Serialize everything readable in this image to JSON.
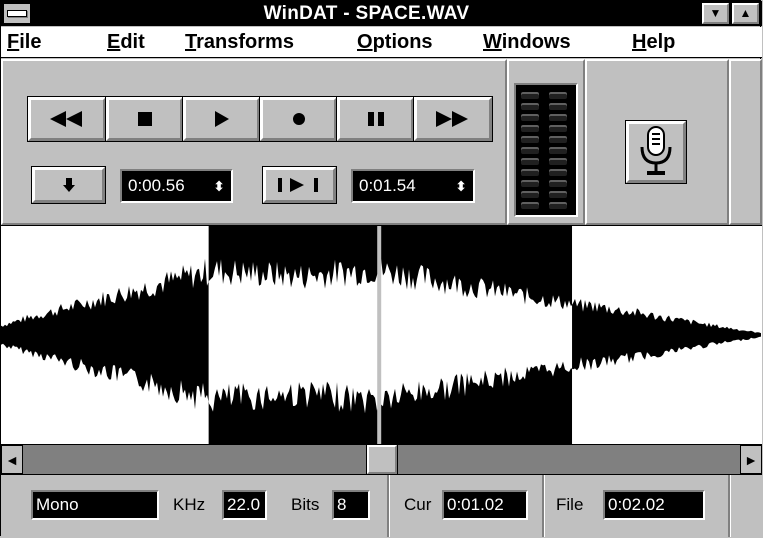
{
  "window": {
    "title": "WinDAT - SPACE.WAV",
    "minimize_glyph": "▼",
    "maximize_glyph": "▲"
  },
  "menu": [
    {
      "first": "F",
      "rest": "ile"
    },
    {
      "first": "E",
      "rest": "dit"
    },
    {
      "first": "T",
      "rest": "ransforms"
    },
    {
      "first": "O",
      "rest": "ptions"
    },
    {
      "first": "W",
      "rest": "indows"
    },
    {
      "first": "H",
      "rest": "elp"
    }
  ],
  "transport": {
    "buttons": [
      "rewind-icon",
      "stop-icon",
      "play-icon",
      "record-icon",
      "pause-icon",
      "fast-forward-icon"
    ]
  },
  "selection": {
    "start_time": "0:00.56",
    "end_time": "0:01.54",
    "spin_glyph": "⬍"
  },
  "waveform": {
    "duration_seconds": 2.02,
    "selection_start_seconds": 0.56,
    "selection_end_seconds": 1.54,
    "cursor_seconds": 1.02
  },
  "scrollbar": {
    "left_arrow": "◄",
    "right_arrow": "►",
    "position_fraction": 0.5
  },
  "status": {
    "channels": "Mono",
    "khz_label": "KHz",
    "khz_value": "22.0",
    "bits_label": "Bits",
    "bits_value": "8",
    "cur_label": "Cur",
    "cur_value": "0:01.02",
    "file_label": "File",
    "file_value": "0:02.02"
  },
  "colors": {
    "face": "#c0c0c0",
    "shadow": "#808080",
    "highlight": "#ffffff",
    "lcd_bg": "#000000",
    "lcd_fg": "#ffffff"
  }
}
